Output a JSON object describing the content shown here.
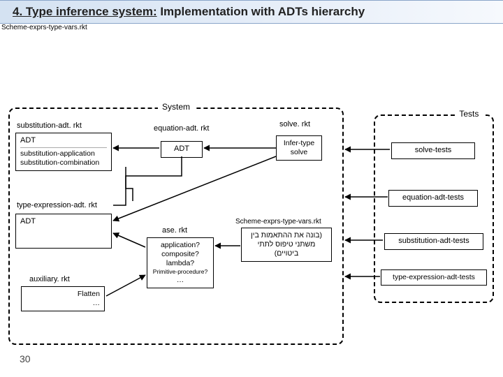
{
  "header": {
    "title_prefix": "4. Type inference system:",
    "title_rest": " Implementation with ADTs hierarchy"
  },
  "system_box": {
    "label": "System"
  },
  "tests_box": {
    "label": "Tests"
  },
  "nodes": {
    "substitution": {
      "title": "substitution-adt. rkt",
      "hdr": "ADT",
      "line1": "substitution-application",
      "line2": "substitution-combination"
    },
    "equation": {
      "title": "equation-adt. rkt",
      "hdr": "ADT"
    },
    "type_expr": {
      "title": "type-expression-adt. rkt",
      "hdr": "ADT"
    },
    "solve": {
      "title": "solve. rkt",
      "line1": "Infer-type",
      "line2": "solve"
    },
    "ase": {
      "title": "ase. rkt",
      "line1": "application?",
      "line2": "composite?",
      "line3": "lambda?",
      "line4": "Primitive-procedure?",
      "line5": "…"
    },
    "scheme": {
      "title": "Scheme-exprs-type-vars.rkt",
      "line1": "(בונה את ההתאמות בין",
      "line2": "משתני טיפוס לתתי",
      "line3": "ביטויים)"
    },
    "auxiliary": {
      "title": "auxiliary. rkt",
      "line1": "Flatten",
      "line2": "…"
    },
    "solve_tests": "solve-tests",
    "equation_adt_tests": "equation-adt-tests",
    "substitution_adt_tests": "substitution-adt-tests",
    "type_expr_adt_tests": "type-expression-adt-tests"
  },
  "slide_number": "30"
}
